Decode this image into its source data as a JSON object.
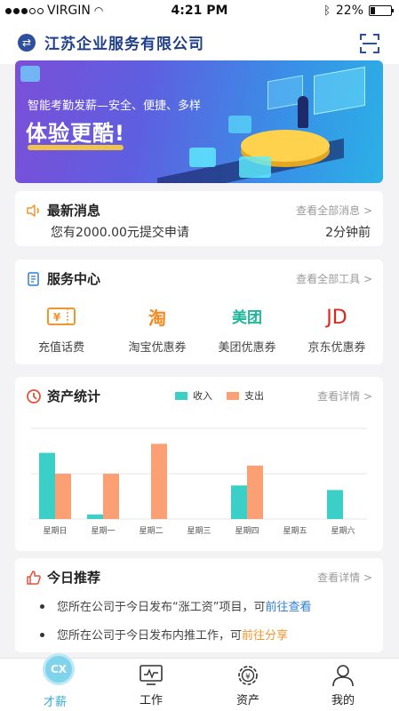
{
  "status_bar": {
    "carrier": "VIRGIN",
    "time": "4:21 PM",
    "battery": "22%",
    "battery_level": 0.22
  },
  "header": {
    "company": "江苏企业服务有限公司"
  },
  "banner": {
    "subtitle": "智能考勤发薪—安全、便捷、多样",
    "headline": "体验更酷!"
  },
  "news": {
    "title": "最新消息",
    "link": "查看全部消息 >",
    "message": "您有2000.00元提交申请",
    "time": "2分钟前"
  },
  "service": {
    "title": "服务中心",
    "link": "查看全部工具 >",
    "items": [
      {
        "label": "充值话费",
        "icon": "phone-recharge-icon",
        "logo": "¥",
        "color": "#f0962e"
      },
      {
        "label": "淘宝优惠券",
        "icon": "taobao-icon",
        "logo": "淘",
        "color": "#f28a1e"
      },
      {
        "label": "美团优惠券",
        "icon": "meituan-icon",
        "logo": "美团",
        "color": "#1fb79a"
      },
      {
        "label": "京东优惠券",
        "icon": "jd-icon",
        "logo": "JD",
        "color": "#e1251b"
      }
    ]
  },
  "assets": {
    "title": "资产统计",
    "link": "查看详情 >",
    "chart_data": {
      "type": "bar",
      "categories": [
        "星期日",
        "星期一",
        "星期二",
        "星期三",
        "星期四",
        "星期五",
        "星期六"
      ],
      "series": [
        {
          "name": "收入",
          "color": "#3ccfc8",
          "values": [
            73,
            5,
            0,
            0,
            37,
            0,
            32
          ]
        },
        {
          "name": "支出",
          "color": "#fb9f75",
          "values": [
            50,
            50,
            83,
            0,
            59,
            0,
            0
          ]
        }
      ],
      "ylim": [
        0,
        100
      ],
      "grid": true
    }
  },
  "recommend": {
    "title": "今日推荐",
    "link": "查看详情 >",
    "items": [
      {
        "text": "您所在公司于今日发布“涨工资”项目，可",
        "action": "前往查看"
      },
      {
        "text": "您所在公司于今日发布内推工作，可",
        "action": "前往分享"
      }
    ]
  },
  "tabbar": {
    "items": [
      {
        "label": "才薪",
        "badge": "CX"
      },
      {
        "label": "工作"
      },
      {
        "label": "资产"
      },
      {
        "label": "我的"
      }
    ]
  }
}
